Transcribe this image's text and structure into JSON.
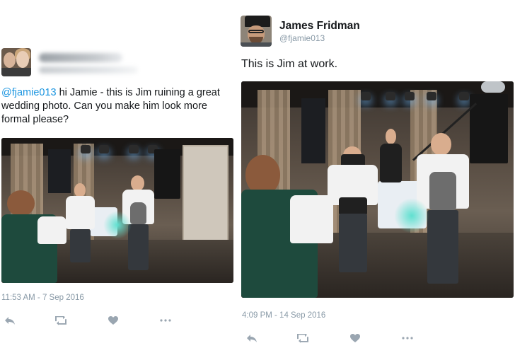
{
  "left_tweet": {
    "mention": "@fjamie013",
    "text": " hi Jamie - this is Jim ruining a great wedding photo. Can you make him look more formal please?",
    "timestamp": "11:53 AM - 7 Sep 2016",
    "actions": [
      "reply-icon",
      "retweet-icon",
      "like-icon",
      "more-icon"
    ]
  },
  "right_tweet": {
    "name": "James Fridman",
    "handle": "@fjamie013",
    "text": "This is Jim at work.",
    "timestamp": "4:09 PM - 14 Sep 2016",
    "actions": [
      "reply-icon",
      "retweet-icon",
      "like-icon",
      "more-icon"
    ]
  },
  "colors": {
    "link": "#1b95e0",
    "meta_text": "#8899a6",
    "icon": "#9aa6b1",
    "body_text": "#14171a"
  }
}
